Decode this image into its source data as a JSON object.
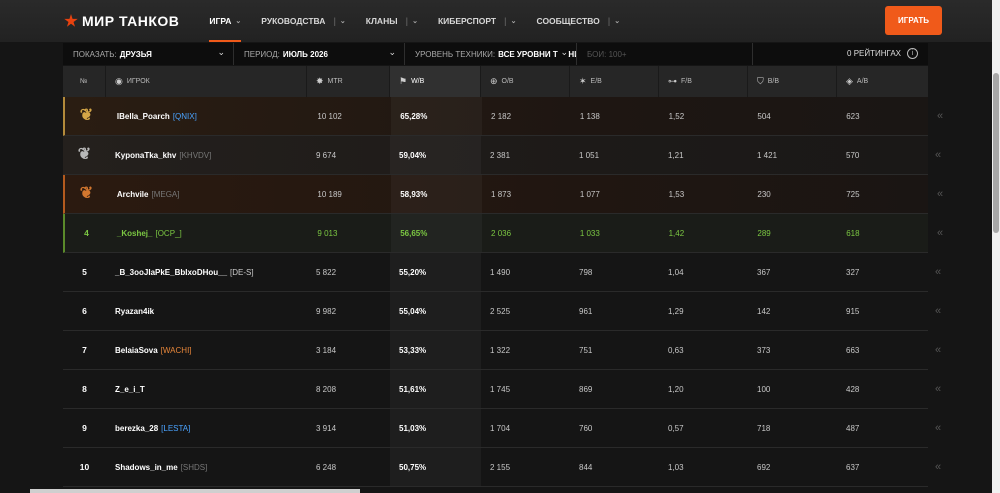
{
  "nav": {
    "logo": "МИР ТАНКОВ",
    "items": [
      {
        "label": "ИГРА",
        "active": true
      },
      {
        "label": "РУКОВОДСТВА",
        "active": false
      },
      {
        "label": "КЛАНЫ",
        "active": false
      },
      {
        "label": "КИБЕРСПОРТ",
        "active": false
      },
      {
        "label": "СООБЩЕСТВО",
        "active": false
      }
    ],
    "play_label": "ИГРАТЬ"
  },
  "filters": {
    "show_label": "ПОКАЗАТЬ:",
    "show_value": "ДРУЗЬЯ",
    "period_label": "ПЕРИОД:",
    "period_value": "ИЮЛЬ 2026",
    "tier_label": "УРОВЕНЬ ТЕХНИКИ:",
    "tier_value": "ВСЕ УРОВНИ ТЕХНИКИ",
    "battles_label": "БОИ: 100+",
    "ratings_label": "0 РЕЙТИНГАХ"
  },
  "table": {
    "headers": {
      "rank": "№",
      "player": "ИГРОК",
      "mtr": "MTR",
      "wb": "W/B",
      "ob": "O/B",
      "eb": "E/B",
      "fb": "F/B",
      "bb": "B/B",
      "ab": "A/B"
    },
    "rows": [
      {
        "rank": "",
        "medal": "gold",
        "name": "IBella_Poarch",
        "clan": "[QNIX]",
        "clan_color": "#4aa3ff",
        "mtr": "10 102",
        "wb": "65,28%",
        "ob": "2 182",
        "eb": "1 138",
        "fb": "1,52",
        "bb": "504",
        "ab": "623"
      },
      {
        "rank": "",
        "medal": "silver",
        "name": "KyponaTka_khv",
        "clan": "[KHVDV]",
        "clan_color": "#777777",
        "mtr": "9 674",
        "wb": "59,04%",
        "ob": "2 381",
        "eb": "1 051",
        "fb": "1,21",
        "bb": "1 421",
        "ab": "570"
      },
      {
        "rank": "",
        "medal": "bronze",
        "name": "Archvile",
        "clan": "[MEGA]",
        "clan_color": "#777777",
        "mtr": "10 189",
        "wb": "58,93%",
        "ob": "1 873",
        "eb": "1 077",
        "fb": "1,53",
        "bb": "230",
        "ab": "725"
      },
      {
        "rank": "4",
        "medal": "",
        "name": "_Koshej_",
        "clan": "[OCP_]",
        "clan_color": "#7bc742",
        "mtr": "9 013",
        "wb": "56,65%",
        "ob": "2 036",
        "eb": "1 033",
        "fb": "1,42",
        "bb": "289",
        "ab": "618"
      },
      {
        "rank": "5",
        "medal": "",
        "name": "_B_3ooJIaPkE_BbIxoDHou__",
        "clan": "[DE-S]",
        "clan_color": "#cccccc",
        "mtr": "5 822",
        "wb": "55,20%",
        "ob": "1 490",
        "eb": "798",
        "fb": "1,04",
        "bb": "367",
        "ab": "327"
      },
      {
        "rank": "6",
        "medal": "",
        "name": "Ryazan4ik",
        "clan": "",
        "clan_color": "#777777",
        "mtr": "9 982",
        "wb": "55,04%",
        "ob": "2 525",
        "eb": "961",
        "fb": "1,29",
        "bb": "142",
        "ab": "915"
      },
      {
        "rank": "7",
        "medal": "",
        "name": "BelaiaSova",
        "clan": "[WACHI]",
        "clan_color": "#e8873a",
        "mtr": "3 184",
        "wb": "53,33%",
        "ob": "1 322",
        "eb": "751",
        "fb": "0,63",
        "bb": "373",
        "ab": "663"
      },
      {
        "rank": "8",
        "medal": "",
        "name": "Z_e_i_T",
        "clan": "",
        "clan_color": "#777777",
        "mtr": "8 208",
        "wb": "51,61%",
        "ob": "1 745",
        "eb": "869",
        "fb": "1,20",
        "bb": "100",
        "ab": "428"
      },
      {
        "rank": "9",
        "medal": "",
        "name": "berezka_28",
        "clan": "[LESTA]",
        "clan_color": "#4aa3ff",
        "mtr": "3 914",
        "wb": "51,03%",
        "ob": "1 704",
        "eb": "760",
        "fb": "0,57",
        "bb": "718",
        "ab": "487"
      },
      {
        "rank": "10",
        "medal": "",
        "name": "Shadows_in_me",
        "clan": "[SHDS]",
        "clan_color": "#777777",
        "mtr": "6 248",
        "wb": "50,75%",
        "ob": "2 155",
        "eb": "844",
        "fb": "1,03",
        "bb": "692",
        "ab": "637"
      }
    ]
  },
  "icons": {
    "medal": "laurel-wreath-icon",
    "expand": "double-chevron-left-icon"
  }
}
